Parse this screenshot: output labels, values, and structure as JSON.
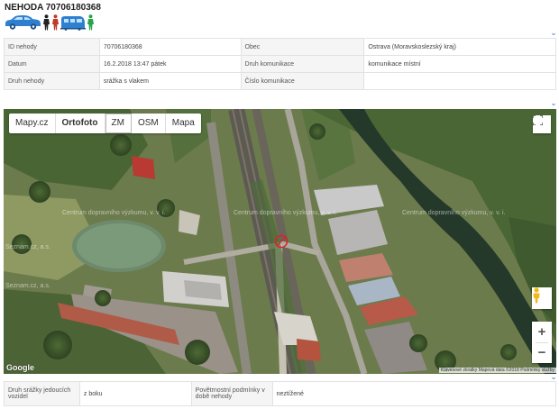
{
  "header": {
    "title": "NEHODA 70706180368"
  },
  "participant_icons": [
    "car-icon",
    "person-black-icon",
    "person-red-icon",
    "train-icon",
    "person-green-icon"
  ],
  "colors": {
    "accent": "#3a78c3",
    "car": "#2f7fd0",
    "tram": "#2f7fd0",
    "person_black": "#222222",
    "person_red": "#c0392b",
    "person_green": "#27a34a",
    "marker": "#e02020",
    "river": "#24392a"
  },
  "info_rows": [
    {
      "k1": "ID nehody",
      "v1": "70706180368",
      "k2": "Obec",
      "v2": "Ostrava (Moravskoslezský kraj)"
    },
    {
      "k1": "Datum",
      "v1": "16.2.2018 13:47 pátek",
      "k2": "Druh komunikace",
      "v2": "komunikace místní"
    },
    {
      "k1": "Druh nehody",
      "v1": "srážka s vlakem",
      "k2": "Číslo komunikace",
      "v2": ""
    }
  ],
  "map": {
    "tabs": [
      "Mapy.cz",
      "Ortofoto",
      "ZM",
      "OSM",
      "Mapa"
    ],
    "active_tab": "Ortofoto",
    "watermark": "Centrum dopravního výzkumu, v. v. i.",
    "sezname": "Seznam.cz, a.s.",
    "google": "Google",
    "attribution": "Klávesové zkratky   Mapová data ©2018   Podmínky služby",
    "zoom_in": "+",
    "zoom_out": "−"
  },
  "detail_rows": [
    {
      "k1": "Druh srážky jedoucích vozidel",
      "v1": "z boku",
      "k2": "Povětrnostní podmínky v době nehody",
      "v2": "neztížené"
    }
  ]
}
